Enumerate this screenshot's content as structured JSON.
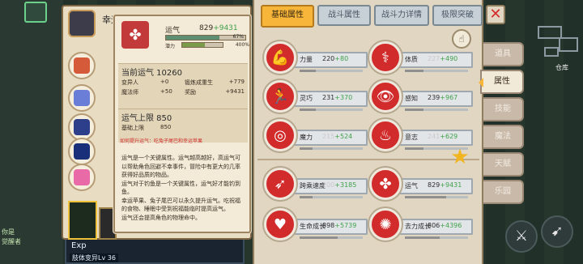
{
  "hud": {
    "left_text_1": "你是",
    "left_text_2": "觉醒者",
    "map_label": "仓库",
    "exp_label": "Exp",
    "exp_sub": "肢体变异Lv 36"
  },
  "character": {
    "name": "幸运"
  },
  "tooltip": {
    "stat_name": "运气",
    "stat_value": "829",
    "stat_bonus": "+9431",
    "progress_pct": "67%",
    "progress_fraction": 0.67,
    "potential_label": "潜力",
    "potential_cap": "400%",
    "potential_fraction": 0.55,
    "current_title": "当前运气 10260",
    "rows": [
      {
        "label": "变异人",
        "value": "+0",
        "label2": "锻炼成重生",
        "value2": "+779"
      },
      {
        "label": "魔法师",
        "value": "+50",
        "label2": "奖励",
        "value2": "+9431"
      }
    ],
    "cap_title": "运气上限 850",
    "cap_base_label": "基础上限",
    "cap_base_value": "850",
    "hint": "如何提升运气：吃兔子尾巴和幸运苹果",
    "desc": "运气是一个关键属性。运气越高越好，高运气可以帮助角色回避不幸事件，冒险中有更大的几率获得好品质的物品。\n运气对于钓鱼是一个关键属性，运气好才能钓到鱼。\n幸运苹果、兔子尾巴可以永久提升运气。吃祝福的食物、睡眠中受到祝福能临时提高运气。\n运气还会提高角色的物理命中。"
  },
  "tabs": [
    {
      "label": "基础属性",
      "active": true
    },
    {
      "label": "战斗属性",
      "active": false
    },
    {
      "label": "战斗力详情",
      "active": false
    },
    {
      "label": "极限突破",
      "active": false
    }
  ],
  "stats": [
    {
      "name": "力量",
      "value": "220",
      "bonus": "+80",
      "icon": "fist-icon",
      "glyph": "💪",
      "faint": false,
      "level": 0.25
    },
    {
      "name": "体质",
      "value": "227",
      "bonus": "+490",
      "icon": "body-icon",
      "glyph": "⚕",
      "faint": true,
      "level": 0.3
    },
    {
      "name": "灵巧",
      "value": "231",
      "bonus": "+370",
      "icon": "running-icon",
      "glyph": "🏃",
      "faint": false,
      "level": 0.25
    },
    {
      "name": "感知",
      "value": "239",
      "bonus": "+967",
      "icon": "eye-icon",
      "glyph": "👁",
      "faint": false,
      "level": 0.3
    },
    {
      "name": "魔力",
      "value": "215",
      "bonus": "+524",
      "icon": "swirl-icon",
      "glyph": "◎",
      "faint": true,
      "level": 0.2
    },
    {
      "name": "意志",
      "value": "241",
      "bonus": "+629",
      "icon": "flame-icon",
      "glyph": "♨",
      "faint": true,
      "level": 0.3
    },
    {
      "name": "跨乘速度",
      "value": "100",
      "bonus": "+3185",
      "icon": "speed-icon",
      "glyph": "➶",
      "faint": true,
      "level": 0.2
    },
    {
      "name": "运气",
      "value": "829",
      "bonus": "+9431",
      "icon": "clover-icon",
      "glyph": "✤",
      "faint": false,
      "level": 0.65
    },
    {
      "name": "生命成长",
      "value": "898",
      "bonus": "+5739",
      "icon": "heart-icon",
      "glyph": "♥",
      "faint": false,
      "level": 0.6
    },
    {
      "name": "去力成长",
      "value": "806",
      "bonus": "+4396",
      "icon": "burst-icon",
      "glyph": "✺",
      "faint": false,
      "level": 0.55
    }
  ],
  "side_menu": [
    {
      "label": "道具",
      "active": false
    },
    {
      "label": "属性",
      "active": true
    },
    {
      "label": "技能",
      "active": false
    },
    {
      "label": "魔法",
      "active": false
    },
    {
      "label": "天赋",
      "active": false
    },
    {
      "label": "乐园",
      "active": false
    }
  ],
  "colors": {
    "accent": "#f7b53a",
    "stat_icon": "#d12b2b",
    "bonus_green": "#3fa14a",
    "hint_red": "#d12c2c"
  }
}
